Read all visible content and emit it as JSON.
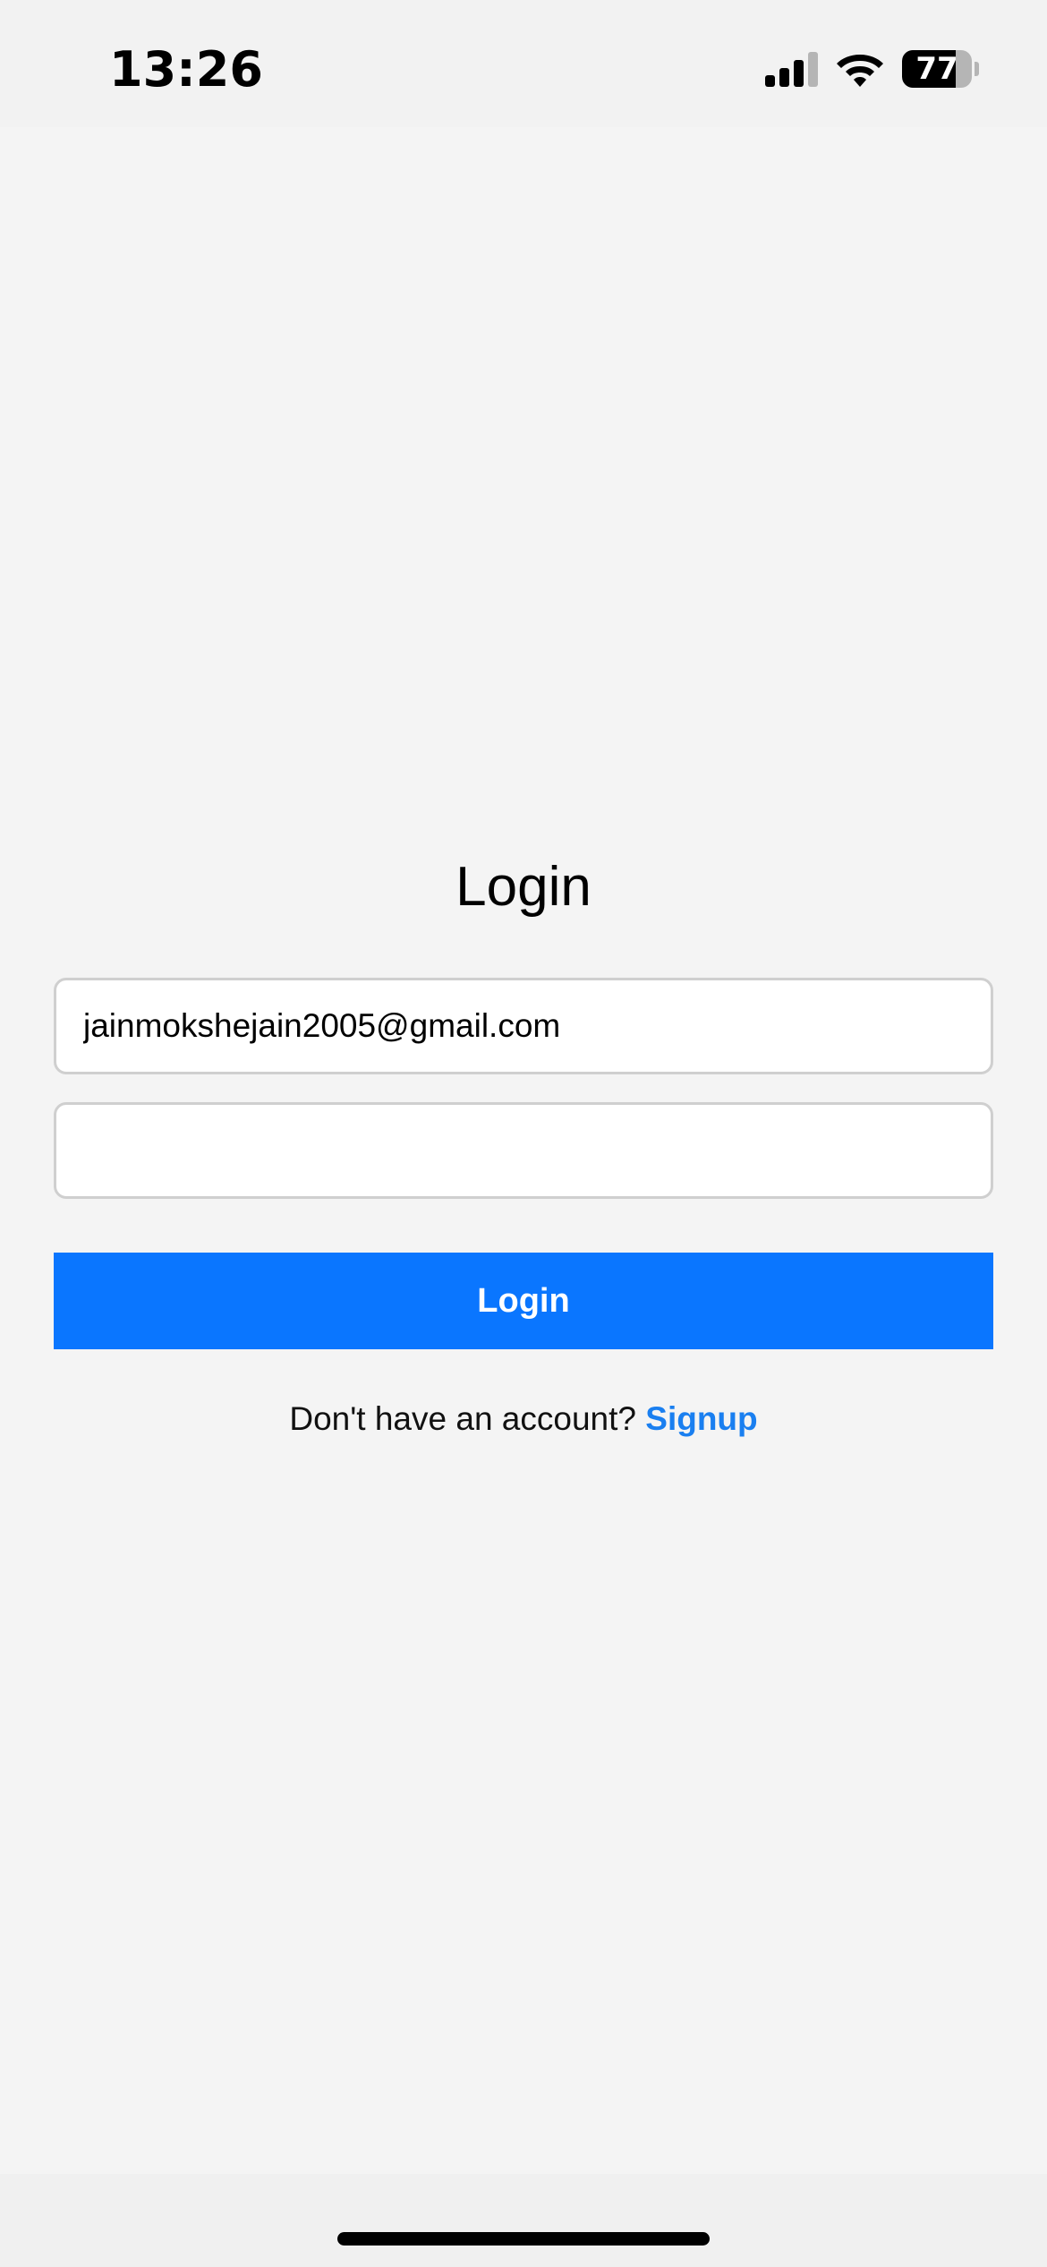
{
  "status_bar": {
    "time": "13:26",
    "battery_level": "77",
    "battery_fraction": 0.77,
    "icons": [
      "signal-icon",
      "wifi-icon",
      "battery-icon"
    ]
  },
  "login": {
    "title": "Login",
    "email_value": "jainmokshejain2005@gmail.com",
    "password_value": "",
    "button_label": "Login",
    "signup_prompt": "Don't have an account?",
    "signup_link": "Signup"
  },
  "colors": {
    "accent": "#0a76ff",
    "link": "#1a7ff0",
    "background": "#f4f4f4"
  }
}
